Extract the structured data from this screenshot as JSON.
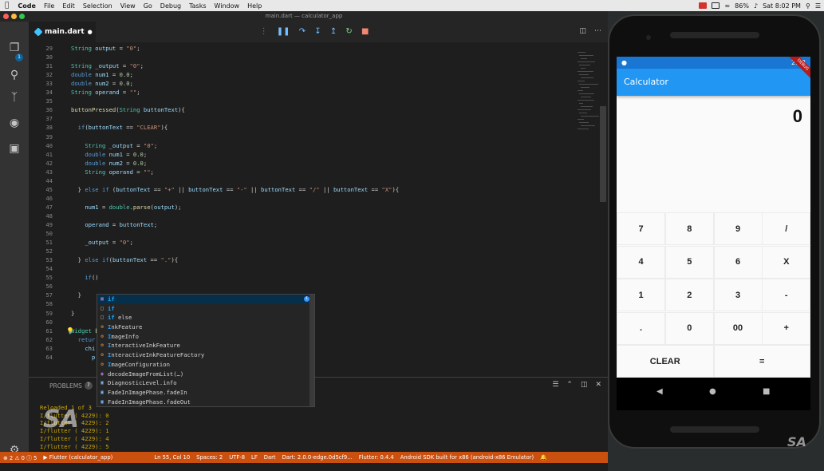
{
  "menubar": {
    "items": [
      "Code",
      "File",
      "Edit",
      "Selection",
      "View",
      "Go",
      "Debug",
      "Tasks",
      "Window",
      "Help"
    ],
    "battery": "86%",
    "clock": "Sat 8:02 PM"
  },
  "window_title": "main.dart — calculator_app",
  "activity_badge": "1",
  "tab": {
    "filename": "main.dart",
    "dirty_marker": "●"
  },
  "code_lines": [
    {
      "n": "29",
      "html": "<span class='ty'>String</span> <span class='va'>output</span> = <span class='st'>\"0\"</span>;"
    },
    {
      "n": "30",
      "html": ""
    },
    {
      "n": "31",
      "html": "<span class='ty'>String</span> <span class='va'>_output</span> = <span class='st'>\"0\"</span>;"
    },
    {
      "n": "32",
      "html": "<span class='kw'>double</span> <span class='va'>num1</span> = <span class='nu'>0.0</span>;"
    },
    {
      "n": "33",
      "html": "<span class='kw'>double</span> <span class='va'>num2</span> = <span class='nu'>0.0</span>;"
    },
    {
      "n": "34",
      "html": "<span class='ty'>String</span> <span class='va'>operand</span> = <span class='st'>\"\"</span>;"
    },
    {
      "n": "35",
      "html": ""
    },
    {
      "n": "36",
      "html": "<span class='fn'>buttonPressed</span>(<span class='ty'>String</span> <span class='va'>buttonText</span>){"
    },
    {
      "n": "37",
      "html": ""
    },
    {
      "n": "38",
      "html": "  <span class='kw'>if</span>(<span class='va'>buttonText</span> == <span class='st'>\"CLEAR\"</span>){"
    },
    {
      "n": "39",
      "html": ""
    },
    {
      "n": "40",
      "html": "    <span class='ty'>String</span> <span class='va'>_output</span> = <span class='st'>\"0\"</span>;"
    },
    {
      "n": "41",
      "html": "    <span class='kw'>double</span> <span class='va'>num1</span> = <span class='nu'>0.0</span>;"
    },
    {
      "n": "42",
      "html": "    <span class='kw'>double</span> <span class='va'>num2</span> = <span class='nu'>0.0</span>;"
    },
    {
      "n": "43",
      "html": "    <span class='ty'>String</span> <span class='va'>operand</span> = <span class='st'>\"\"</span>;"
    },
    {
      "n": "44",
      "html": ""
    },
    {
      "n": "45",
      "html": "  } <span class='kw'>else if</span> (<span class='va'>buttonText</span> == <span class='st'>\"+\"</span> || <span class='va'>buttonText</span> == <span class='st'>\"-\"</span> || <span class='va'>buttonText</span> == <span class='st'>\"/\"</span> || <span class='va'>buttonText</span> == <span class='st'>\"X\"</span>){"
    },
    {
      "n": "46",
      "html": ""
    },
    {
      "n": "47",
      "html": "    <span class='va'>num1</span> = <span class='ty'>double</span>.<span class='fn'>parse</span>(<span class='va'>output</span>);"
    },
    {
      "n": "48",
      "html": ""
    },
    {
      "n": "49",
      "html": "    <span class='va'>operand</span> = <span class='va'>buttonText</span>;"
    },
    {
      "n": "50",
      "html": ""
    },
    {
      "n": "51",
      "html": "    <span class='va'>_output</span> = <span class='st'>\"0\"</span>;"
    },
    {
      "n": "52",
      "html": ""
    },
    {
      "n": "53",
      "html": "  } <span class='kw'>else if</span>(<span class='va'>buttonText</span> == <span class='st'>\".\"</span>){"
    },
    {
      "n": "54",
      "html": ""
    },
    {
      "n": "55",
      "html": "    <span class='kw'>if</span>()"
    },
    {
      "n": "56",
      "html": ""
    },
    {
      "n": "57",
      "html": "  }"
    },
    {
      "n": "58",
      "html": ""
    },
    {
      "n": "59",
      "html": "}"
    },
    {
      "n": "60",
      "html": ""
    },
    {
      "n": "61",
      "html": "<span class='ty'>Widget</span> <span class='fn'>b</span>"
    },
    {
      "n": "62",
      "html": "  <span class='kw'>retur</span>"
    },
    {
      "n": "63",
      "html": "    <span class='va'>chi</span>"
    },
    {
      "n": "64",
      "html": "      <span class='va'>p</span>"
    }
  ],
  "suggestions": [
    {
      "icon": "kw",
      "pre": "",
      "hl": "if",
      "post": "",
      "selected": true
    },
    {
      "icon": "sn",
      "pre": "",
      "hl": "if",
      "post": "",
      "selected": false
    },
    {
      "icon": "sn",
      "pre": "",
      "hl": "if",
      "post": " else",
      "selected": false
    },
    {
      "icon": "cl",
      "pre": "",
      "hl": "I",
      "post": "nkFeature",
      "selected": false
    },
    {
      "icon": "cl",
      "pre": "",
      "hl": "I",
      "post": "mageInfo",
      "selected": false
    },
    {
      "icon": "cl",
      "pre": "",
      "hl": "I",
      "post": "nteractiveInkFeature",
      "selected": false
    },
    {
      "icon": "cl",
      "pre": "",
      "hl": "I",
      "post": "nteractiveInkFeatureFactory",
      "selected": false
    },
    {
      "icon": "cl",
      "pre": "",
      "hl": "I",
      "post": "mageConfiguration",
      "selected": false
    },
    {
      "icon": "mt",
      "pre": "",
      "hl": "",
      "post": "decodeImageFromList(…)",
      "selected": false
    },
    {
      "icon": "en",
      "pre": "",
      "hl": "",
      "post": "DiagnosticLevel.info",
      "selected": false
    },
    {
      "icon": "en",
      "pre": "",
      "hl": "",
      "post": "FadeInImagePhase.fadeIn",
      "selected": false
    },
    {
      "icon": "en",
      "pre": "",
      "hl": "",
      "post": "FadeInImagePhase.fadeOut",
      "selected": false
    }
  ],
  "panel": {
    "problems_label": "PROBLEMS",
    "problems_count": "7",
    "output_lines": [
      "Reloaded 1 of 3",
      "I/flutter ( 4229): 0",
      "I/flutter ( 4229): 2",
      "I/flutter ( 4229): 1",
      "I/flutter ( 4229): 4",
      "I/flutter ( 4229): 5"
    ]
  },
  "statusbar": {
    "problems": "⊗ 2 ⚠ 0 ⓘ 5",
    "debug_session": "▶ Flutter (calculator_app)",
    "cursor": "Ln 55, Col 10",
    "spaces": "Spaces: 2",
    "encoding": "UTF-8",
    "eol": "LF",
    "language": "Dart",
    "dart_version": "Dart: 2.0.0-edge.0d5cf9...",
    "flutter_version": "Flutter: 0.4.4",
    "device": "Android SDK built for x86 (android-x86 Emulator)"
  },
  "phone": {
    "clock": "2:32",
    "app_title": "Calculator",
    "display_value": "0",
    "debug_banner": "DEBUG",
    "keys": [
      [
        "7",
        "8",
        "9",
        "/"
      ],
      [
        "4",
        "5",
        "6",
        "X"
      ],
      [
        "1",
        "2",
        "3",
        "-"
      ],
      [
        ".",
        "0",
        "00",
        "+"
      ]
    ],
    "clear_label": "CLEAR",
    "equals_label": "="
  },
  "watermark_text": "SA"
}
